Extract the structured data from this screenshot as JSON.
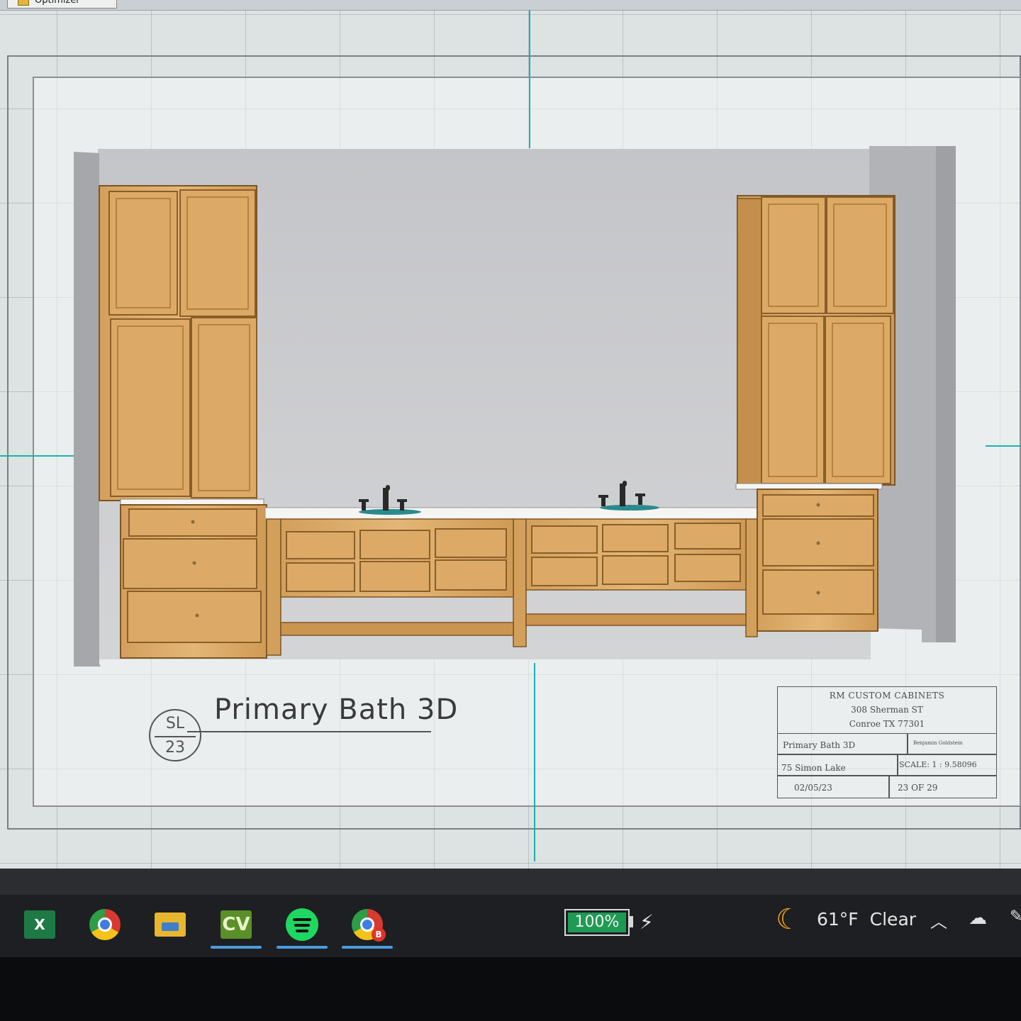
{
  "window": {
    "tab_label": "Optimizer"
  },
  "drawing": {
    "view_title": "Primary Bath 3D",
    "callout": {
      "top": "SL",
      "bottom": "23"
    },
    "title_block": {
      "company": "RM CUSTOM CABINETS",
      "address_line1": "308 Sherman ST",
      "address_line2": "Conroe TX 77301",
      "title": "Primary Bath 3D",
      "drawn_by": "Benjamin Goldstein",
      "address": "75 Simon Lake",
      "scale": "SCALE: 1 : 9.58096",
      "date": "02/05/23",
      "sheet": "23 OF 29"
    }
  },
  "taskbar": {
    "apps": [
      {
        "name": "Excel",
        "glyph": "X"
      },
      {
        "name": "Chrome"
      },
      {
        "name": "File Explorer"
      },
      {
        "name": "Cabinet Vision",
        "glyph": "CV"
      },
      {
        "name": "Spotify"
      },
      {
        "name": "Chrome profile",
        "badge": "B"
      }
    ],
    "battery": {
      "percent_text": "100%",
      "level": 1.0
    },
    "weather": {
      "temp": "61°F",
      "condition": "Clear"
    }
  },
  "colors": {
    "wood": "#d9a863",
    "wood_dark": "#a8773a",
    "wall": "#c8c9cb",
    "countertop": "#f4f4f2",
    "battery_green": "#1f9a55"
  }
}
